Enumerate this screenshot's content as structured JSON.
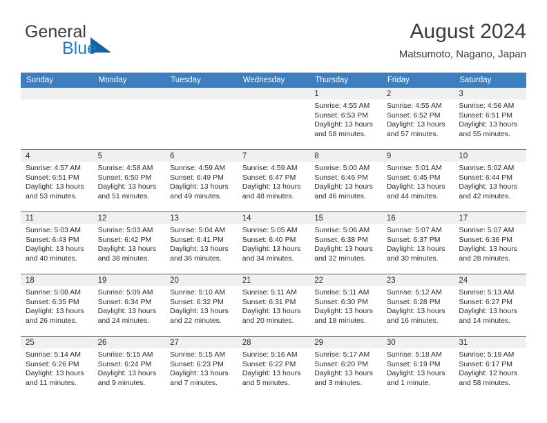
{
  "brand": {
    "name_part1": "General",
    "name_part2": "Blue",
    "triangle_color": "#1163a5",
    "blue_color": "#1b7fc4"
  },
  "header": {
    "title": "August 2024",
    "subtitle": "Matsumoto, Nagano, Japan"
  },
  "theme": {
    "header_blue": "#3c7ebf",
    "daynum_band": "#f0f0f0",
    "text": "#2b2b2b"
  },
  "weekday_headers": [
    "Sunday",
    "Monday",
    "Tuesday",
    "Wednesday",
    "Thursday",
    "Friday",
    "Saturday"
  ],
  "weeks": [
    [
      {
        "day": "",
        "sunrise": "",
        "sunset": "",
        "daylight_line1": "",
        "daylight_line2": ""
      },
      {
        "day": "",
        "sunrise": "",
        "sunset": "",
        "daylight_line1": "",
        "daylight_line2": ""
      },
      {
        "day": "",
        "sunrise": "",
        "sunset": "",
        "daylight_line1": "",
        "daylight_line2": ""
      },
      {
        "day": "",
        "sunrise": "",
        "sunset": "",
        "daylight_line1": "",
        "daylight_line2": ""
      },
      {
        "day": "1",
        "sunrise": "Sunrise: 4:55 AM",
        "sunset": "Sunset: 6:53 PM",
        "daylight_line1": "Daylight: 13 hours",
        "daylight_line2": "and 58 minutes."
      },
      {
        "day": "2",
        "sunrise": "Sunrise: 4:55 AM",
        "sunset": "Sunset: 6:52 PM",
        "daylight_line1": "Daylight: 13 hours",
        "daylight_line2": "and 57 minutes."
      },
      {
        "day": "3",
        "sunrise": "Sunrise: 4:56 AM",
        "sunset": "Sunset: 6:51 PM",
        "daylight_line1": "Daylight: 13 hours",
        "daylight_line2": "and 55 minutes."
      }
    ],
    [
      {
        "day": "4",
        "sunrise": "Sunrise: 4:57 AM",
        "sunset": "Sunset: 6:51 PM",
        "daylight_line1": "Daylight: 13 hours",
        "daylight_line2": "and 53 minutes."
      },
      {
        "day": "5",
        "sunrise": "Sunrise: 4:58 AM",
        "sunset": "Sunset: 6:50 PM",
        "daylight_line1": "Daylight: 13 hours",
        "daylight_line2": "and 51 minutes."
      },
      {
        "day": "6",
        "sunrise": "Sunrise: 4:59 AM",
        "sunset": "Sunset: 6:49 PM",
        "daylight_line1": "Daylight: 13 hours",
        "daylight_line2": "and 49 minutes."
      },
      {
        "day": "7",
        "sunrise": "Sunrise: 4:59 AM",
        "sunset": "Sunset: 6:47 PM",
        "daylight_line1": "Daylight: 13 hours",
        "daylight_line2": "and 48 minutes."
      },
      {
        "day": "8",
        "sunrise": "Sunrise: 5:00 AM",
        "sunset": "Sunset: 6:46 PM",
        "daylight_line1": "Daylight: 13 hours",
        "daylight_line2": "and 46 minutes."
      },
      {
        "day": "9",
        "sunrise": "Sunrise: 5:01 AM",
        "sunset": "Sunset: 6:45 PM",
        "daylight_line1": "Daylight: 13 hours",
        "daylight_line2": "and 44 minutes."
      },
      {
        "day": "10",
        "sunrise": "Sunrise: 5:02 AM",
        "sunset": "Sunset: 6:44 PM",
        "daylight_line1": "Daylight: 13 hours",
        "daylight_line2": "and 42 minutes."
      }
    ],
    [
      {
        "day": "11",
        "sunrise": "Sunrise: 5:03 AM",
        "sunset": "Sunset: 6:43 PM",
        "daylight_line1": "Daylight: 13 hours",
        "daylight_line2": "and 40 minutes."
      },
      {
        "day": "12",
        "sunrise": "Sunrise: 5:03 AM",
        "sunset": "Sunset: 6:42 PM",
        "daylight_line1": "Daylight: 13 hours",
        "daylight_line2": "and 38 minutes."
      },
      {
        "day": "13",
        "sunrise": "Sunrise: 5:04 AM",
        "sunset": "Sunset: 6:41 PM",
        "daylight_line1": "Daylight: 13 hours",
        "daylight_line2": "and 36 minutes."
      },
      {
        "day": "14",
        "sunrise": "Sunrise: 5:05 AM",
        "sunset": "Sunset: 6:40 PM",
        "daylight_line1": "Daylight: 13 hours",
        "daylight_line2": "and 34 minutes."
      },
      {
        "day": "15",
        "sunrise": "Sunrise: 5:06 AM",
        "sunset": "Sunset: 6:38 PM",
        "daylight_line1": "Daylight: 13 hours",
        "daylight_line2": "and 32 minutes."
      },
      {
        "day": "16",
        "sunrise": "Sunrise: 5:07 AM",
        "sunset": "Sunset: 6:37 PM",
        "daylight_line1": "Daylight: 13 hours",
        "daylight_line2": "and 30 minutes."
      },
      {
        "day": "17",
        "sunrise": "Sunrise: 5:07 AM",
        "sunset": "Sunset: 6:36 PM",
        "daylight_line1": "Daylight: 13 hours",
        "daylight_line2": "and 28 minutes."
      }
    ],
    [
      {
        "day": "18",
        "sunrise": "Sunrise: 5:08 AM",
        "sunset": "Sunset: 6:35 PM",
        "daylight_line1": "Daylight: 13 hours",
        "daylight_line2": "and 26 minutes."
      },
      {
        "day": "19",
        "sunrise": "Sunrise: 5:09 AM",
        "sunset": "Sunset: 6:34 PM",
        "daylight_line1": "Daylight: 13 hours",
        "daylight_line2": "and 24 minutes."
      },
      {
        "day": "20",
        "sunrise": "Sunrise: 5:10 AM",
        "sunset": "Sunset: 6:32 PM",
        "daylight_line1": "Daylight: 13 hours",
        "daylight_line2": "and 22 minutes."
      },
      {
        "day": "21",
        "sunrise": "Sunrise: 5:11 AM",
        "sunset": "Sunset: 6:31 PM",
        "daylight_line1": "Daylight: 13 hours",
        "daylight_line2": "and 20 minutes."
      },
      {
        "day": "22",
        "sunrise": "Sunrise: 5:11 AM",
        "sunset": "Sunset: 6:30 PM",
        "daylight_line1": "Daylight: 13 hours",
        "daylight_line2": "and 18 minutes."
      },
      {
        "day": "23",
        "sunrise": "Sunrise: 5:12 AM",
        "sunset": "Sunset: 6:28 PM",
        "daylight_line1": "Daylight: 13 hours",
        "daylight_line2": "and 16 minutes."
      },
      {
        "day": "24",
        "sunrise": "Sunrise: 5:13 AM",
        "sunset": "Sunset: 6:27 PM",
        "daylight_line1": "Daylight: 13 hours",
        "daylight_line2": "and 14 minutes."
      }
    ],
    [
      {
        "day": "25",
        "sunrise": "Sunrise: 5:14 AM",
        "sunset": "Sunset: 6:26 PM",
        "daylight_line1": "Daylight: 13 hours",
        "daylight_line2": "and 11 minutes."
      },
      {
        "day": "26",
        "sunrise": "Sunrise: 5:15 AM",
        "sunset": "Sunset: 6:24 PM",
        "daylight_line1": "Daylight: 13 hours",
        "daylight_line2": "and 9 minutes."
      },
      {
        "day": "27",
        "sunrise": "Sunrise: 5:15 AM",
        "sunset": "Sunset: 6:23 PM",
        "daylight_line1": "Daylight: 13 hours",
        "daylight_line2": "and 7 minutes."
      },
      {
        "day": "28",
        "sunrise": "Sunrise: 5:16 AM",
        "sunset": "Sunset: 6:22 PM",
        "daylight_line1": "Daylight: 13 hours",
        "daylight_line2": "and 5 minutes."
      },
      {
        "day": "29",
        "sunrise": "Sunrise: 5:17 AM",
        "sunset": "Sunset: 6:20 PM",
        "daylight_line1": "Daylight: 13 hours",
        "daylight_line2": "and 3 minutes."
      },
      {
        "day": "30",
        "sunrise": "Sunrise: 5:18 AM",
        "sunset": "Sunset: 6:19 PM",
        "daylight_line1": "Daylight: 13 hours",
        "daylight_line2": "and 1 minute."
      },
      {
        "day": "31",
        "sunrise": "Sunrise: 5:19 AM",
        "sunset": "Sunset: 6:17 PM",
        "daylight_line1": "Daylight: 12 hours",
        "daylight_line2": "and 58 minutes."
      }
    ]
  ]
}
